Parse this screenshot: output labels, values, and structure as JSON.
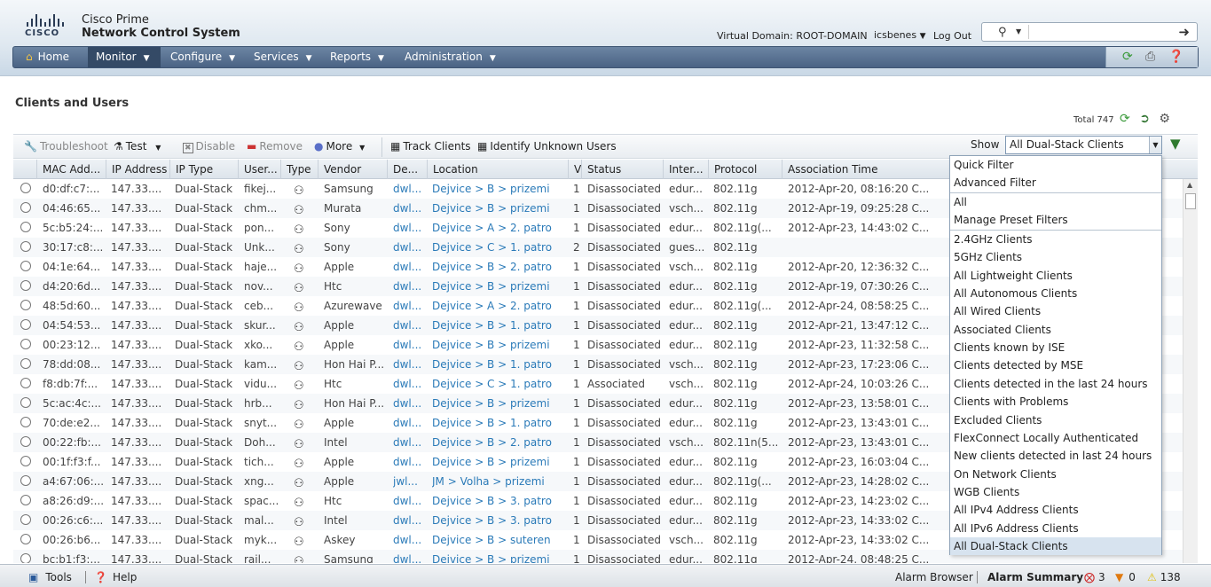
{
  "header": {
    "product_line1": "Cisco Prime",
    "product_line2": "Network Control System",
    "logo_text": "CISCO",
    "virtual_domain": "Virtual Domain: ROOT-DOMAIN",
    "user": "icsbenes",
    "logout": "Log Out"
  },
  "nav": {
    "home": "Home",
    "monitor": "Monitor",
    "configure": "Configure",
    "services": "Services",
    "reports": "Reports",
    "administration": "Administration"
  },
  "page": {
    "title": "Clients and Users",
    "total": "Total 747"
  },
  "toolbar": {
    "troubleshoot": "Troubleshoot",
    "test": "Test",
    "disable": "Disable",
    "remove": "Remove",
    "more": "More",
    "track_clients": "Track Clients",
    "identify_unknown": "Identify Unknown Users",
    "show_label": "Show",
    "show_value": "All Dual-Stack Clients"
  },
  "table": {
    "columns": [
      "MAC Add...",
      "IP Address",
      "IP Type",
      "User...",
      "Type",
      "Vendor",
      "De...",
      "Location",
      "V",
      "Status",
      "Inter...",
      "Protocol",
      "Association Time"
    ],
    "rows": [
      [
        "d0:df:c7:...",
        "147.33....",
        "Dual-Stack",
        "fikej...",
        "Samsung",
        "dwl...",
        "Dejvice > B > prizemi",
        "1",
        "Disassociated",
        "edur...",
        "802.11g",
        "2012-Apr-20, 08:16:20 C..."
      ],
      [
        "04:46:65...",
        "147.33....",
        "Dual-Stack",
        "chm...",
        "Murata",
        "dwl...",
        "Dejvice > B > prizemi",
        "1",
        "Disassociated",
        "vsch...",
        "802.11g",
        "2012-Apr-19, 09:25:28 C..."
      ],
      [
        "5c:b5:24:...",
        "147.33....",
        "Dual-Stack",
        "pon...",
        "Sony",
        "dwl...",
        "Dejvice > A > 2. patro",
        "1",
        "Disassociated",
        "edur...",
        "802.11g(...",
        "2012-Apr-23, 14:43:02 C..."
      ],
      [
        "30:17:c8:...",
        "147.33....",
        "Dual-Stack",
        "Unk...",
        "Sony",
        "dwl...",
        "Dejvice > C > 1. patro",
        "2",
        "Disassociated",
        "gues...",
        "802.11g",
        ""
      ],
      [
        "04:1e:64...",
        "147.33....",
        "Dual-Stack",
        "haje...",
        "Apple",
        "dwl...",
        "Dejvice > B > 2. patro",
        "1",
        "Disassociated",
        "vsch...",
        "802.11g",
        "2012-Apr-20, 12:36:32 C..."
      ],
      [
        "d4:20:6d...",
        "147.33....",
        "Dual-Stack",
        "nov...",
        "Htc",
        "dwl...",
        "Dejvice > B > prizemi",
        "1",
        "Disassociated",
        "edur...",
        "802.11g",
        "2012-Apr-19, 07:30:26 C..."
      ],
      [
        "48:5d:60...",
        "147.33....",
        "Dual-Stack",
        "ceb...",
        "Azurewave",
        "dwl...",
        "Dejvice > A > 2. patro",
        "1",
        "Disassociated",
        "edur...",
        "802.11g(...",
        "2012-Apr-24, 08:58:25 C..."
      ],
      [
        "04:54:53...",
        "147.33....",
        "Dual-Stack",
        "skur...",
        "Apple",
        "dwl...",
        "Dejvice > B > 1. patro",
        "1",
        "Disassociated",
        "edur...",
        "802.11g",
        "2012-Apr-21, 13:47:12 C..."
      ],
      [
        "00:23:12...",
        "147.33....",
        "Dual-Stack",
        "xko...",
        "Apple",
        "dwl...",
        "Dejvice > B > prizemi",
        "1",
        "Disassociated",
        "edur...",
        "802.11g",
        "2012-Apr-23, 11:32:58 C..."
      ],
      [
        "78:dd:08...",
        "147.33....",
        "Dual-Stack",
        "kam...",
        "Hon Hai P...",
        "dwl...",
        "Dejvice > B > 1. patro",
        "1",
        "Disassociated",
        "vsch...",
        "802.11g",
        "2012-Apr-23, 17:23:06 C..."
      ],
      [
        "f8:db:7f:...",
        "147.33....",
        "Dual-Stack",
        "vidu...",
        "Htc",
        "dwl...",
        "Dejvice > C > 1. patro",
        "1",
        "Associated",
        "vsch...",
        "802.11g",
        "2012-Apr-24, 10:03:26 C..."
      ],
      [
        "5c:ac:4c:...",
        "147.33....",
        "Dual-Stack",
        "hrb...",
        "Hon Hai P...",
        "dwl...",
        "Dejvice > B > prizemi",
        "1",
        "Disassociated",
        "edur...",
        "802.11g",
        "2012-Apr-23, 13:58:01 C..."
      ],
      [
        "70:de:e2...",
        "147.33....",
        "Dual-Stack",
        "snyt...",
        "Apple",
        "dwl...",
        "Dejvice > B > 1. patro",
        "1",
        "Disassociated",
        "edur...",
        "802.11g",
        "2012-Apr-23, 13:43:01 C..."
      ],
      [
        "00:22:fb:...",
        "147.33....",
        "Dual-Stack",
        "Doh...",
        "Intel",
        "dwl...",
        "Dejvice > B > 2. patro",
        "1",
        "Disassociated",
        "vsch...",
        "802.11n(5...",
        "2012-Apr-23, 13:43:01 C..."
      ],
      [
        "00:1f:f3:f...",
        "147.33....",
        "Dual-Stack",
        "tich...",
        "Apple",
        "dwl...",
        "Dejvice > B > prizemi",
        "1",
        "Disassociated",
        "edur...",
        "802.11g",
        "2012-Apr-23, 16:03:04 C..."
      ],
      [
        "a4:67:06:...",
        "147.33....",
        "Dual-Stack",
        "xng...",
        "Apple",
        "jwl...",
        "JM > Volha > prizemi",
        "1",
        "Disassociated",
        "edur...",
        "802.11g(...",
        "2012-Apr-23, 14:28:02 C..."
      ],
      [
        "a8:26:d9:...",
        "147.33....",
        "Dual-Stack",
        "spac...",
        "Htc",
        "dwl...",
        "Dejvice > B > 3. patro",
        "1",
        "Disassociated",
        "edur...",
        "802.11g",
        "2012-Apr-23, 14:23:02 C..."
      ],
      [
        "00:26:c6:...",
        "147.33....",
        "Dual-Stack",
        "mal...",
        "Intel",
        "dwl...",
        "Dejvice > B > 3. patro",
        "1",
        "Disassociated",
        "edur...",
        "802.11g",
        "2012-Apr-23, 14:33:02 C..."
      ],
      [
        "00:26:b6...",
        "147.33....",
        "Dual-Stack",
        "myk...",
        "Askey",
        "dwl...",
        "Dejvice > B > suteren",
        "1",
        "Disassociated",
        "vsch...",
        "802.11g",
        "2012-Apr-23, 14:33:02 C..."
      ],
      [
        "bc:b1:f3:...",
        "147.33....",
        "Dual-Stack",
        "rail...",
        "Samsung",
        "dwl...",
        "Dejvice > B > prizemi",
        "1",
        "Disassociated",
        "edur...",
        "802.11g",
        "2012-Apr-24, 08:48:25 C..."
      ]
    ]
  },
  "menu": {
    "groups": [
      [
        "Quick Filter",
        "Advanced Filter"
      ],
      [
        "All",
        "Manage Preset Filters"
      ],
      [
        "2.4GHz Clients",
        "5GHz Clients",
        "All Lightweight Clients",
        "All Autonomous Clients",
        "All Wired Clients",
        "Associated Clients",
        "Clients known by ISE",
        "Clients detected by MSE",
        "Clients detected in the last 24 hours",
        "Clients with Problems",
        "Excluded Clients",
        "FlexConnect Locally Authenticated",
        "New clients detected in last 24 hours",
        "On Network Clients",
        "WGB Clients",
        "All IPv4 Address Clients",
        "All IPv6 Address Clients",
        "All Dual-Stack Clients"
      ]
    ],
    "selected": "All Dual-Stack Clients"
  },
  "footer": {
    "tools": "Tools",
    "help": "Help",
    "alarm_browser": "Alarm Browser",
    "alarm_summary": "Alarm Summary",
    "critical": "3",
    "major": "0",
    "minor": "138"
  },
  "colors": {
    "nav": "#4a6384",
    "link": "#2a7ab8"
  }
}
